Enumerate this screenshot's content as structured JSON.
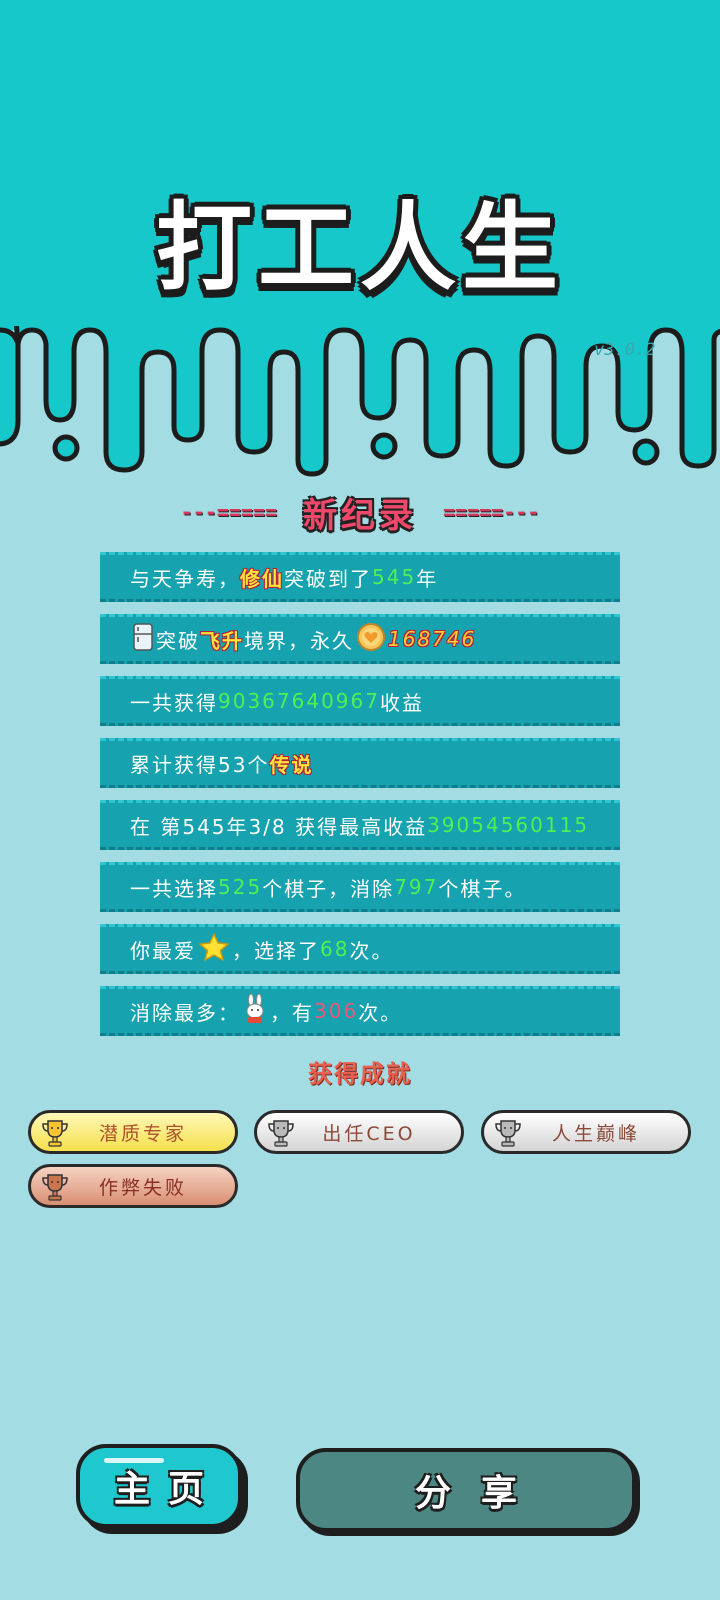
{
  "app_title": "打工人生",
  "version": "v3.0.2",
  "colors": {
    "header_bg": "#16c8c9",
    "page_bg": "#a3dde3",
    "record_bg": "#16a2ae",
    "highlight_green": "#4ef053",
    "highlight_yellow": "#ffe23b",
    "home_button": "#1ec8ce",
    "share_button": "#4d8783"
  },
  "records_section": {
    "title": "新纪录",
    "left_dashes": "---=====",
    "right_dashes": "=====---"
  },
  "records": [
    {
      "parts": [
        "与天争寿，",
        "修仙",
        "突破到了",
        "545",
        "年"
      ]
    },
    {
      "icon": "fridge-icon",
      "parts": [
        "突破",
        "飞升",
        "境界，永久",
        "168746"
      ],
      "coin_icon": "heart-coin-icon"
    },
    {
      "parts": [
        "一共获得",
        "90367640967",
        "收益"
      ]
    },
    {
      "parts": [
        "累计获得53个",
        "传说"
      ]
    },
    {
      "parts": [
        "在 第545年3/8 获得最高收益",
        "39054560115"
      ]
    },
    {
      "parts": [
        "一共选择",
        "525",
        "个棋子，消除",
        "797",
        "个棋子。"
      ]
    },
    {
      "icon": "star-icon",
      "parts": [
        "你最爱",
        "，选择了",
        "68",
        "次。"
      ]
    },
    {
      "icon": "rabbit-icon",
      "parts": [
        "消除最多：",
        "，有",
        "306",
        "次。"
      ]
    }
  ],
  "achievements_section": {
    "title": "获得成就",
    "items": [
      {
        "label": "潜质专家",
        "tier": "gold",
        "icon": "trophy-icon"
      },
      {
        "label": "出任CEO",
        "tier": "silver",
        "icon": "trophy-icon"
      },
      {
        "label": "人生巅峰",
        "tier": "silver",
        "icon": "trophy-icon"
      },
      {
        "label": "作弊失败",
        "tier": "bronze",
        "icon": "trophy-icon"
      }
    ]
  },
  "buttons": {
    "home": "主页",
    "share": "分享"
  }
}
